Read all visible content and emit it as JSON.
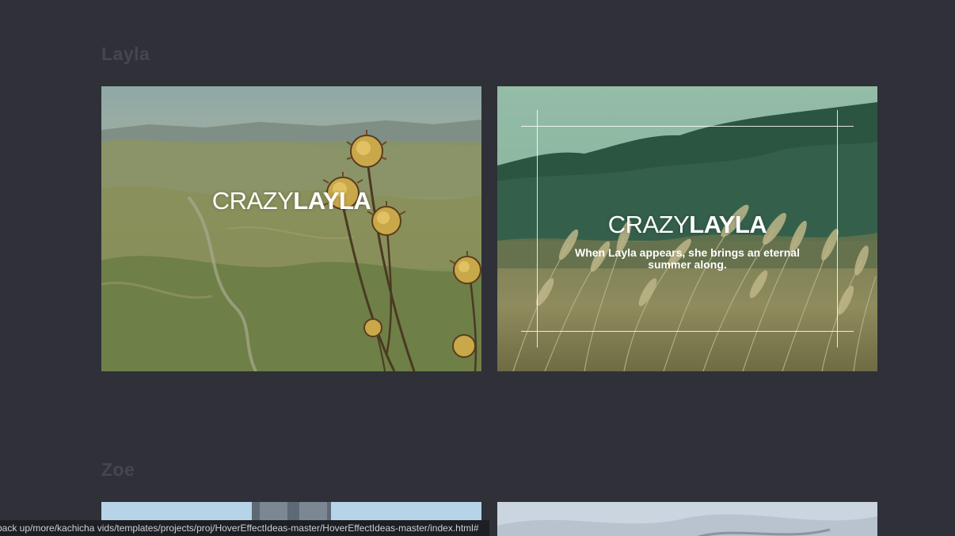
{
  "sections": [
    {
      "title": "Layla",
      "cards": [
        {
          "title_light": "CRAZY",
          "title_bold": "LAYLA",
          "description": ""
        },
        {
          "title_light": "CRAZY",
          "title_bold": "LAYLA",
          "description": "When Layla appears, she brings an eternal summer along."
        }
      ]
    },
    {
      "title": "Zoe"
    }
  ],
  "status_bar": {
    "url": "back up/more/kachicha vids/templates/projects/proj/HoverEffectIdeas-master/HoverEffectIdeas-master/index.html#"
  },
  "colors": {
    "background": "#2f3038",
    "section_title": "#45474f"
  }
}
